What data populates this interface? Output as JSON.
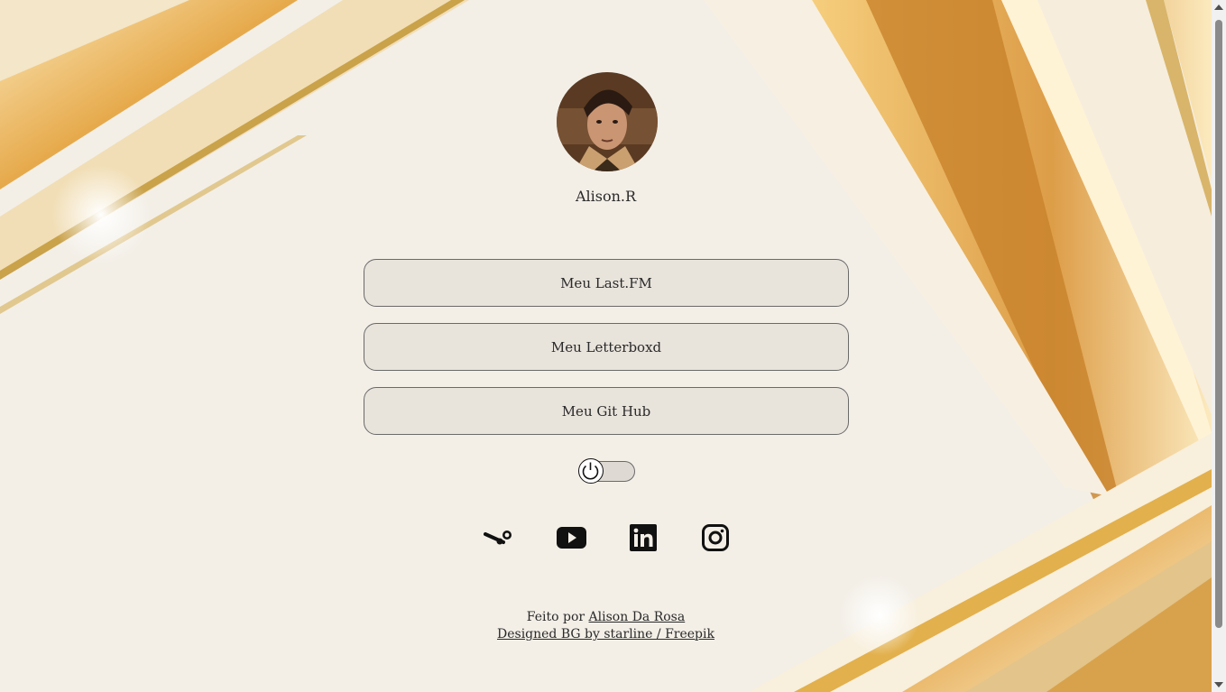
{
  "profile": {
    "name": "Alison.R",
    "avatar_icon": "profile-photo"
  },
  "links": [
    {
      "label": "Meu Last.FM"
    },
    {
      "label": "Meu Letterboxd"
    },
    {
      "label": "Meu Git Hub"
    }
  ],
  "theme_toggle": {
    "icon": "power-icon",
    "state": "off"
  },
  "social": [
    {
      "icon": "steam-icon"
    },
    {
      "icon": "youtube-icon"
    },
    {
      "icon": "linkedin-icon"
    },
    {
      "icon": "instagram-icon"
    }
  ],
  "footer": {
    "made_by_prefix": "Feito por",
    "author_link": "Alison Da Rosa",
    "credit_link": "Designed BG by starline / Freepik"
  },
  "colors": {
    "background": "#f3efe7",
    "gold": "#e6b24f",
    "text": "#2a2a2a"
  }
}
